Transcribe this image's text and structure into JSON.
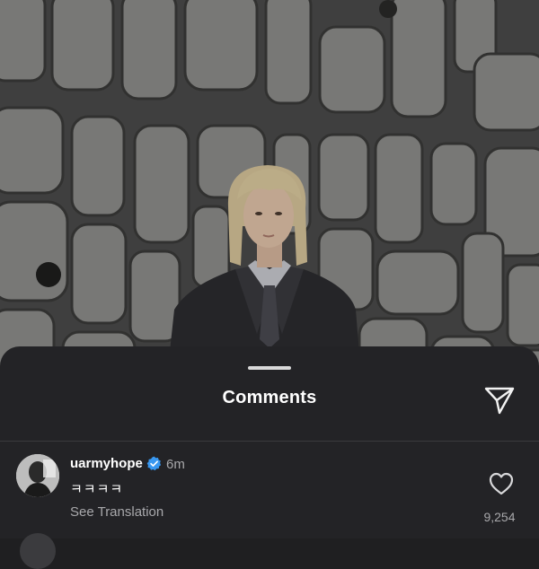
{
  "photo": {
    "description_icon": "photo"
  },
  "sheet": {
    "title": "Comments",
    "share_icon": "send-icon"
  },
  "comments": [
    {
      "username": "uarmyhope",
      "verified": true,
      "time": "6m",
      "text": "ㅋㅋㅋㅋ",
      "translation_link": "See Translation",
      "likes": "9,254"
    }
  ],
  "colors": {
    "sheet_bg": "#232326",
    "text_primary": "#ffffff",
    "text_secondary": "#a8a8ab",
    "verified_blue": "#3897f0"
  }
}
